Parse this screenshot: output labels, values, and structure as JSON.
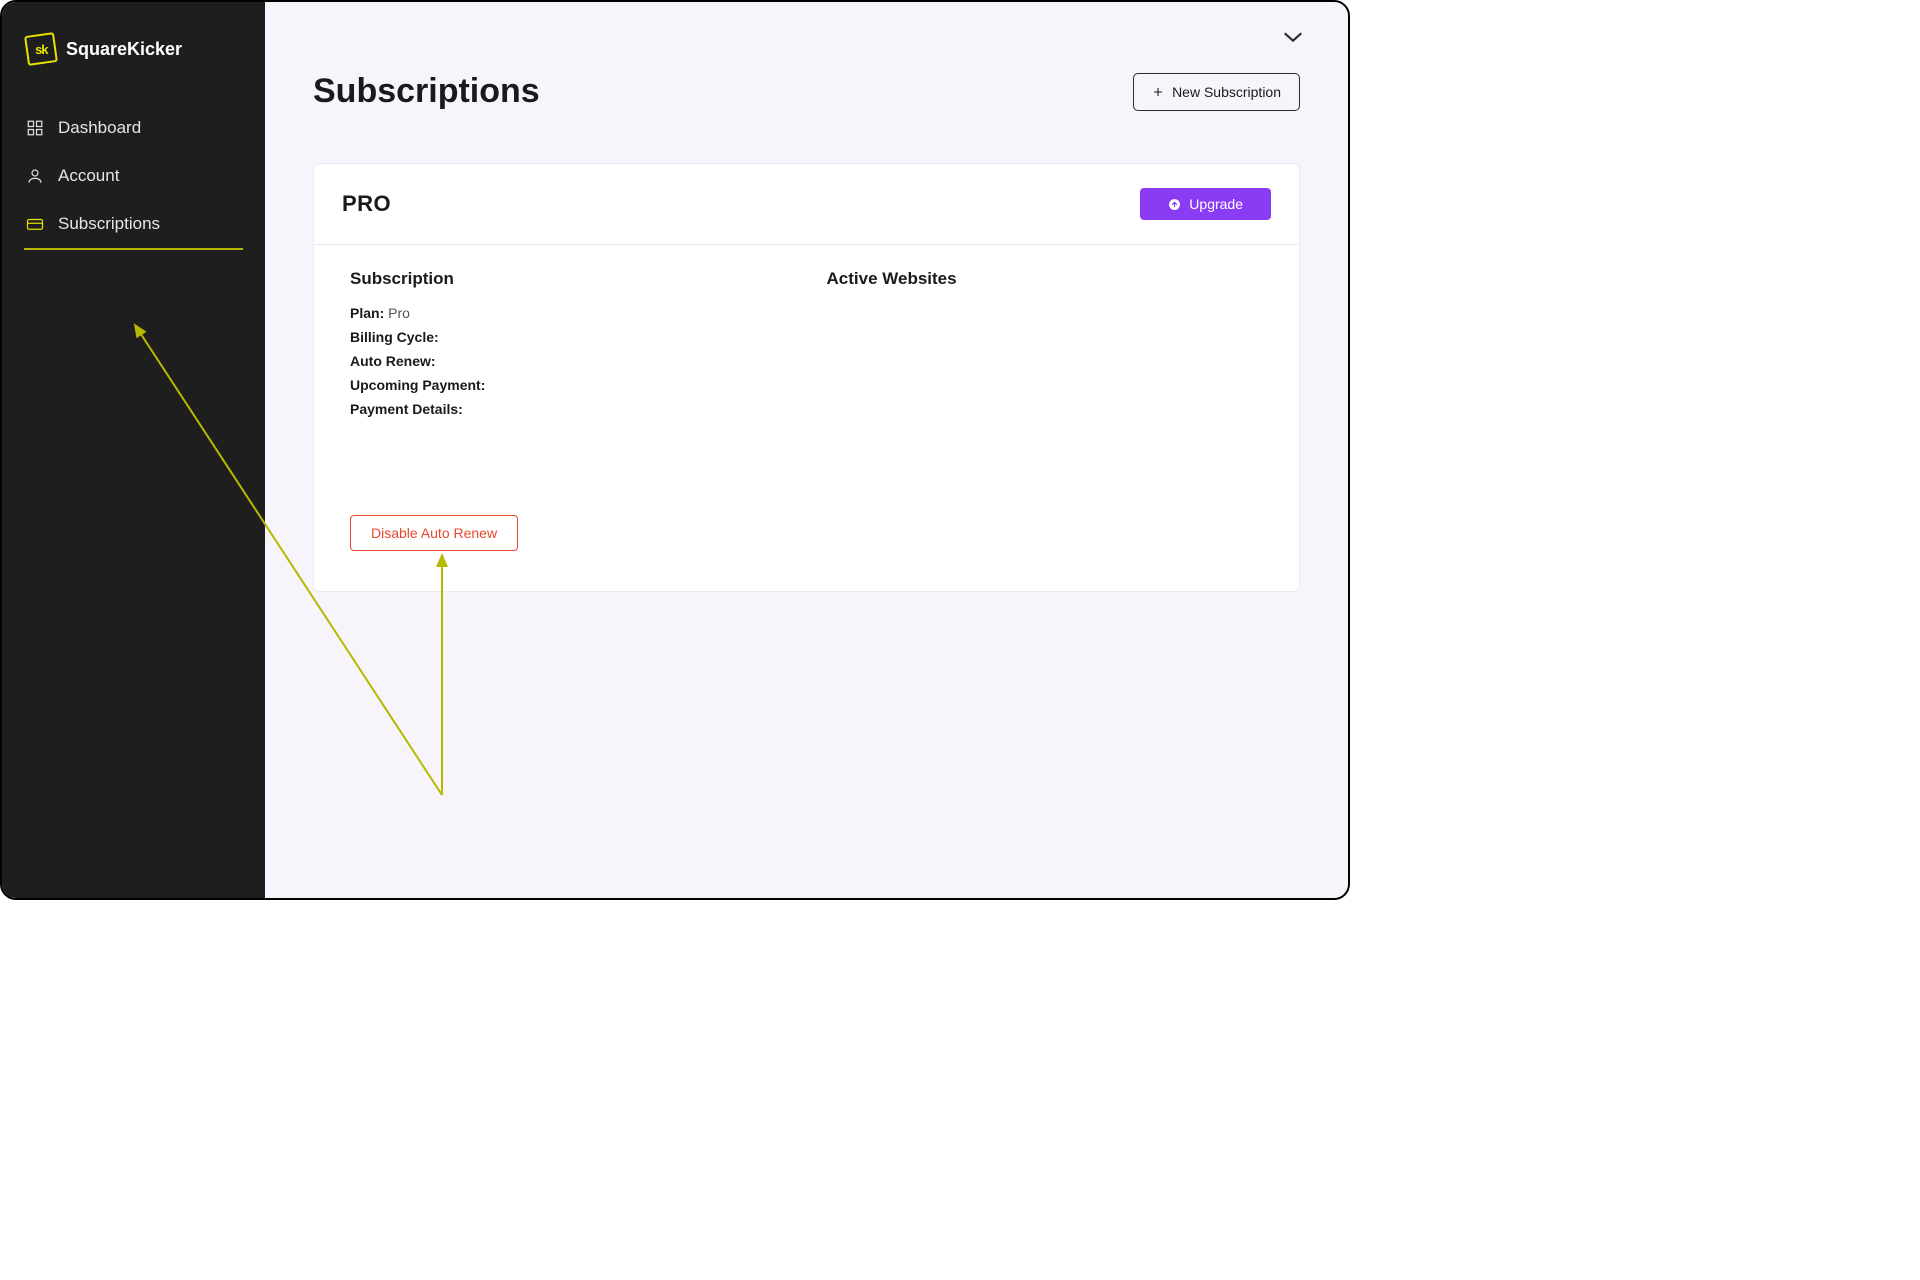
{
  "brand": {
    "name": "SquareKicker",
    "logo_text": "sk"
  },
  "sidebar": {
    "items": [
      {
        "label": "Dashboard",
        "icon": "dashboard-icon"
      },
      {
        "label": "Account",
        "icon": "account-icon"
      },
      {
        "label": "Subscriptions",
        "icon": "subscriptions-icon"
      }
    ],
    "active_index": 2
  },
  "page": {
    "title": "Subscriptions",
    "new_subscription_label": "New Subscription"
  },
  "subscription_card": {
    "plan_name": "PRO",
    "upgrade_label": "Upgrade",
    "section_subscription_title": "Subscription",
    "section_websites_title": "Active Websites",
    "details": {
      "plan_label": "Plan:",
      "plan_value": "Pro",
      "billing_cycle_label": "Billing Cycle:",
      "billing_cycle_value": "",
      "auto_renew_label": "Auto Renew:",
      "auto_renew_value": "",
      "upcoming_payment_label": "Upcoming Payment:",
      "upcoming_payment_value": "",
      "payment_details_label": "Payment Details:",
      "payment_details_value": ""
    },
    "disable_auto_renew_label": "Disable Auto Renew"
  },
  "colors": {
    "sidebar_bg": "#1e1e1e",
    "accent_yellow": "#e8e000",
    "primary_purple": "#8a3cf5",
    "danger_red": "#e7492e",
    "page_bg": "#f7f5fb"
  }
}
